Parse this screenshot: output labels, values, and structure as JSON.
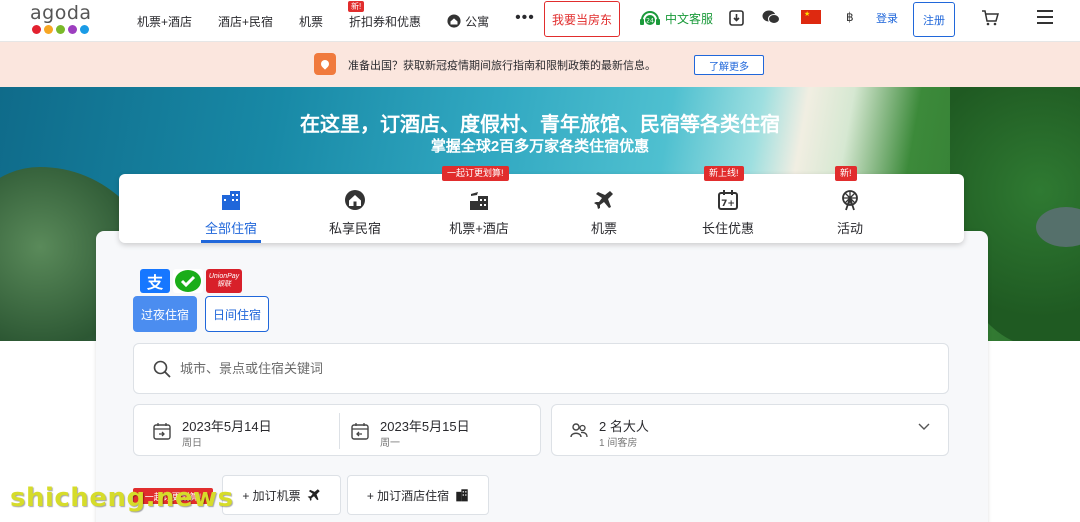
{
  "header": {
    "logo_text": "agoda",
    "logo_colors": [
      "#e3212f",
      "#f6a623",
      "#7ab929",
      "#9d3ebf",
      "#1a9be6"
    ],
    "nav": [
      {
        "label": "机票+酒店",
        "badge": ""
      },
      {
        "label": "酒店+民宿",
        "badge": ""
      },
      {
        "label": "机票",
        "badge": ""
      },
      {
        "label": "折扣券和优惠",
        "badge": "新!"
      },
      {
        "label": "公寓",
        "badge": ""
      }
    ],
    "more_label": "•••",
    "host_button": "我要当房东",
    "customer_service": "中文客服",
    "currency": "฿",
    "login": "登录",
    "register": "注册"
  },
  "notice": {
    "text": "准备出国？获取新冠疫情期间旅行指南和限制政策的最新信息。",
    "button": "了解更多"
  },
  "hero": {
    "title": "在这里，订酒店、度假村、青年旅馆、民宿等各类住宿",
    "subtitle": "掌握全球2百多万家各类住宿优惠"
  },
  "tabs": [
    {
      "label": "全部住宿",
      "badge": "",
      "icon": "building-icon",
      "active": true
    },
    {
      "label": "私享民宿",
      "badge": "",
      "icon": "house-icon",
      "active": false
    },
    {
      "label": "机票+酒店",
      "badge": "一起订更划算!",
      "icon": "flight-hotel-icon",
      "active": false
    },
    {
      "label": "机票",
      "badge": "",
      "icon": "airplane-icon",
      "active": false
    },
    {
      "label": "长住优惠",
      "badge": "新上线!",
      "icon": "calendar-7-icon",
      "active": false
    },
    {
      "label": "活动",
      "badge": "新!",
      "icon": "ferris-wheel-icon",
      "active": false
    }
  ],
  "payment_logos": {
    "alipay": "支",
    "unionpay_top": "UnionPay",
    "unionpay_bottom": "银联"
  },
  "stay_type": {
    "overnight": "过夜住宿",
    "day_use": "日间住宿"
  },
  "search": {
    "placeholder": "城市、景点或住宿关键词"
  },
  "check_in": {
    "date": "2023年5月14日",
    "weekday": "周日"
  },
  "check_out": {
    "date": "2023年5月15日",
    "weekday": "周一"
  },
  "guests": {
    "main": "2 名大人",
    "sub": "1 间客房"
  },
  "addons": {
    "badge": "一起订更划算!",
    "flight": "+ 加订机票",
    "hotel": "+ 加订酒店住宿"
  },
  "watermark": "shicheng.news",
  "colors": {
    "accent": "#2067da",
    "badge_red": "#e12d2d",
    "service_green": "#1a9a3a"
  }
}
